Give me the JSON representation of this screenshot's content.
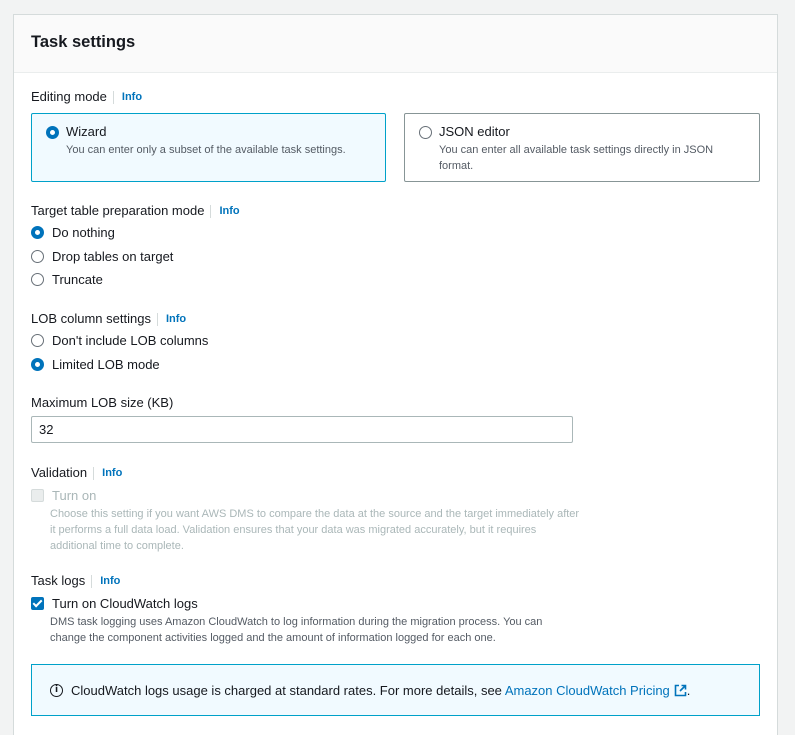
{
  "panel": {
    "title": "Task settings"
  },
  "info_label": "Info",
  "editing_mode": {
    "label": "Editing mode",
    "options": [
      {
        "title": "Wizard",
        "description": "You can enter only a subset of the available task settings.",
        "selected": true
      },
      {
        "title": "JSON editor",
        "description": "You can enter all available task settings directly in JSON format.",
        "selected": false
      }
    ]
  },
  "target_prep": {
    "label": "Target table preparation mode",
    "options": [
      {
        "label": "Do nothing",
        "selected": true
      },
      {
        "label": "Drop tables on target",
        "selected": false
      },
      {
        "label": "Truncate",
        "selected": false
      }
    ]
  },
  "lob": {
    "label": "LOB column settings",
    "options": [
      {
        "label": "Don't include LOB columns",
        "selected": false
      },
      {
        "label": "Limited LOB mode",
        "selected": true
      }
    ]
  },
  "max_lob": {
    "label": "Maximum LOB size (KB)",
    "value": "32"
  },
  "validation": {
    "label": "Validation",
    "checkbox_label": "Turn on",
    "description": "Choose this setting if you want AWS DMS to compare the data at the source and the target immediately after it performs a full data load. Validation ensures that your data was migrated accurately, but it requires additional time to complete.",
    "checked": false,
    "disabled": true
  },
  "task_logs": {
    "label": "Task logs",
    "checkbox_label": "Turn on CloudWatch logs",
    "description": "DMS task logging uses Amazon CloudWatch to log information during the migration process. You can change the component activities logged and the amount of information logged for each one.",
    "checked": true
  },
  "alert": {
    "text": "CloudWatch logs usage is charged at standard rates. For more details, see ",
    "link_text": "Amazon CloudWatch Pricing",
    "suffix": "."
  },
  "colors": {
    "accent": "#0073bb",
    "selected_border": "#00a1c9",
    "selected_bg": "#f1faff"
  }
}
